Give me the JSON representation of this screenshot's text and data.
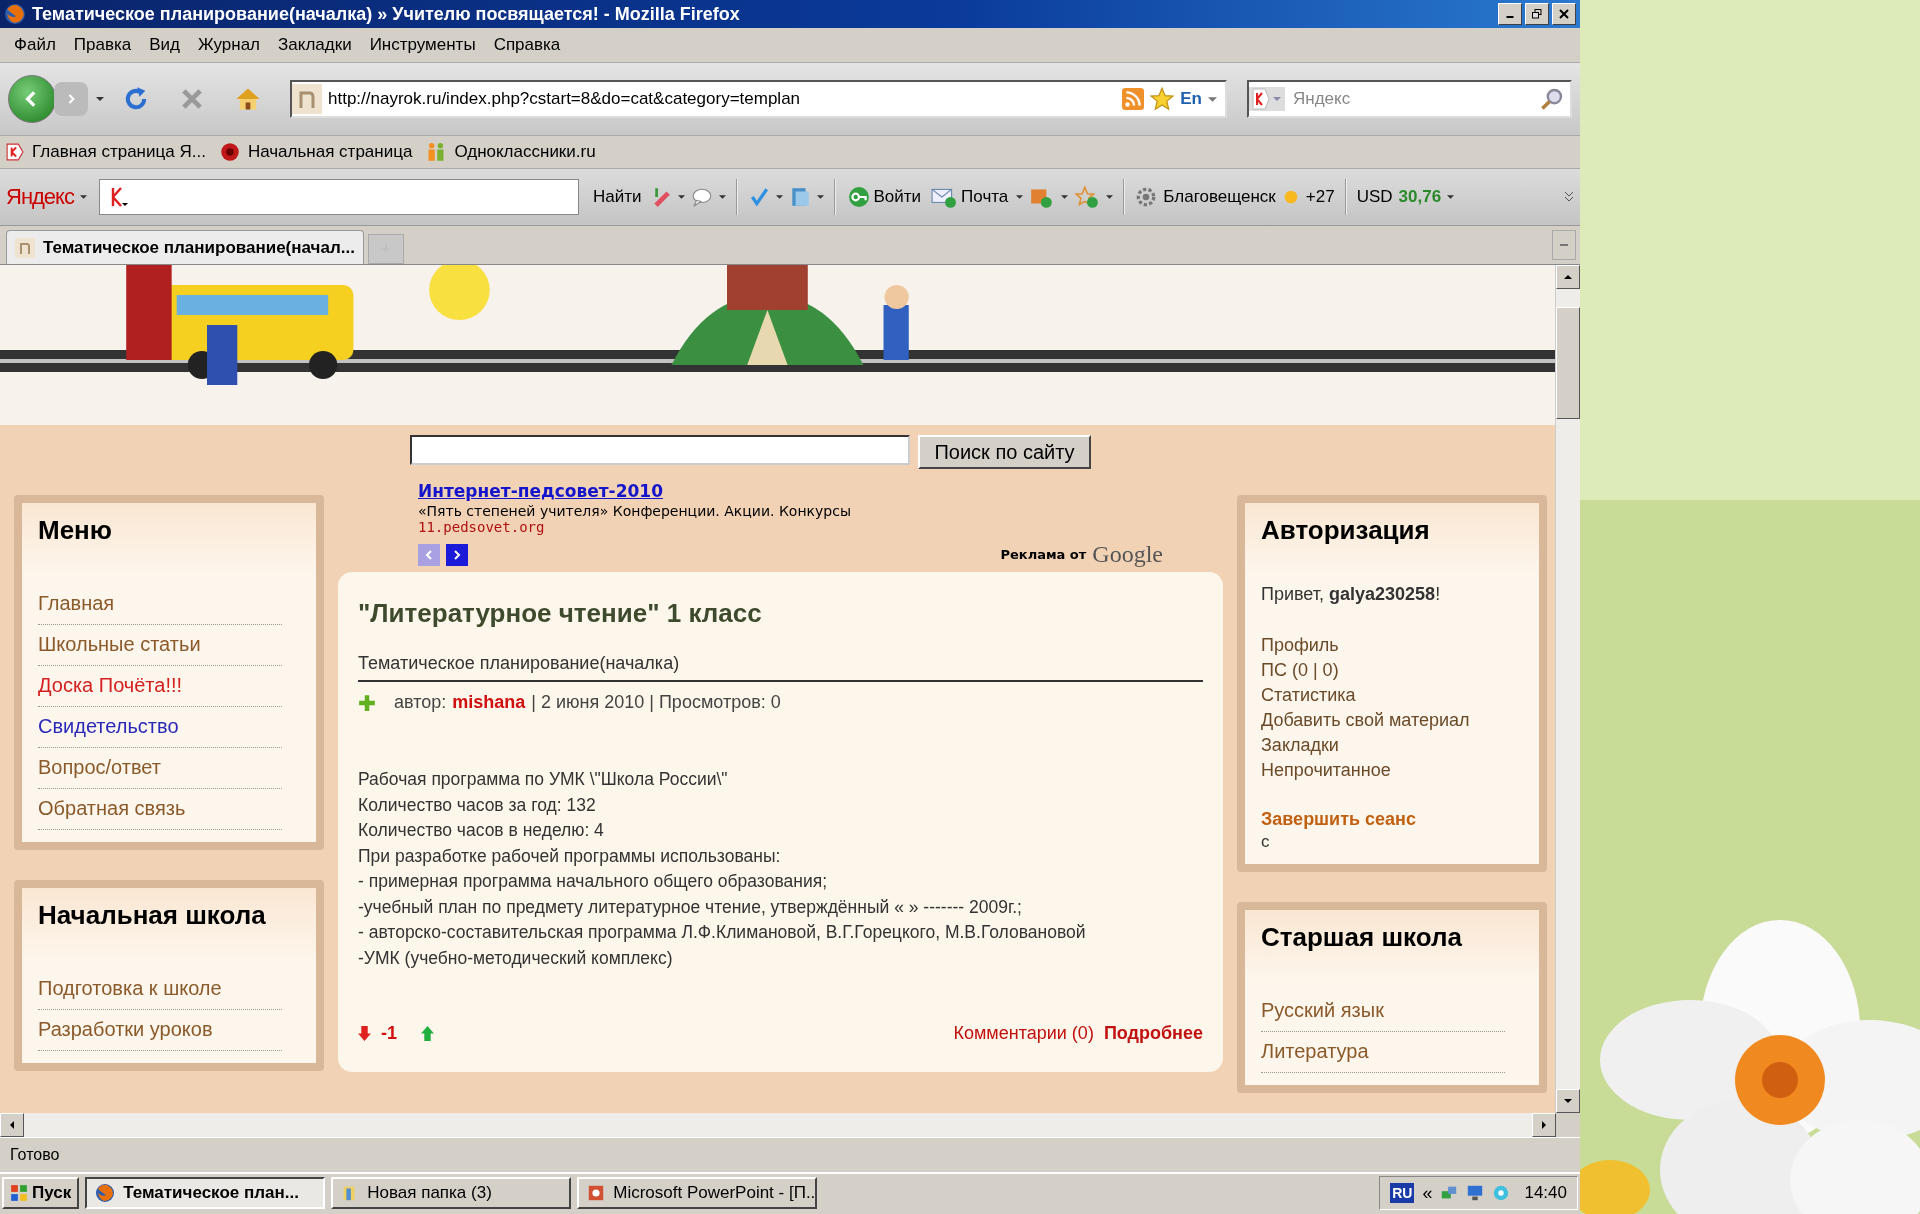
{
  "window": {
    "title": "Тематическое планирование(началка) » Учителю посвящается! - Mozilla Firefox"
  },
  "menu": [
    "Файл",
    "Правка",
    "Вид",
    "Журнал",
    "Закладки",
    "Инструменты",
    "Справка"
  ],
  "navigation": {
    "url": "http://nayrok.ru/index.php?cstart=8&do=cat&category=templan",
    "lang": "En",
    "search_placeholder": "Яндекс"
  },
  "bookmarks": [
    "Главная страница Я...",
    "Начальная страница",
    "Одноклассники.ru"
  ],
  "yandex_bar": {
    "brand": "Яндекс",
    "find": "Найти",
    "login": "Войти",
    "mail": "Почта",
    "city": "Благовещенск",
    "temperature": "+27",
    "currency": "USD",
    "rate": "30,76"
  },
  "tabs": [
    {
      "label": "Тематическое планирование(начал...",
      "selected": true
    }
  ],
  "site": {
    "search_button": "Поиск по сайту",
    "ad": {
      "title": "Интернет-педсовет-2010",
      "text": "«Пять степеней учителя» Конференции. Акции. Конкурсы",
      "url": "11.pedsovet.org",
      "footer": "Реклама от",
      "brand": "Google"
    },
    "left_blocks": [
      {
        "title": "Меню",
        "items": [
          {
            "label": "Главная",
            "color": "#8b5a2b"
          },
          {
            "label": "Школьные статьи",
            "color": "#8b5a2b"
          },
          {
            "label": "Доска Почёта!!!",
            "color": "#d42020"
          },
          {
            "label": "Свидетельство",
            "color": "#2a2ab8"
          },
          {
            "label": "Вопрос/ответ",
            "color": "#8b5a2b"
          },
          {
            "label": "Обратная связь",
            "color": "#8b5a2b"
          }
        ]
      },
      {
        "title": "Начальная школа",
        "items": [
          {
            "label": "Подготовка к школе",
            "color": "#8b5a2b"
          },
          {
            "label": "Разработки уроков",
            "color": "#8b5a2b"
          }
        ]
      }
    ],
    "article": {
      "title": "\"Литературное чтение\" 1 класс",
      "category": "Тематическое планирование(началка)",
      "author_label": "автор:",
      "author": "mishana",
      "meta": "| 2 июня 2010 | Просмотров: 0",
      "lines": [
        "Рабочая программа по УМК \\\"Школа России\\\"",
        "Количество часов за год: 132",
        "Количество часов в неделю: 4",
        "При разработке рабочей программы использованы:",
        "- примерная программа начального общего образования;",
        "-учебный план по предмету литературное чтение, утверждённый « » ------- 2009г.;",
        "- авторско-составительская программа Л.Ф.Климановой, В.Г.Горецкого, М.В.Головановой",
        "-УМК (учебно-методический комплекс)"
      ],
      "rating": "-1",
      "comments": "Комментарии (0)",
      "more": "Подробнее"
    },
    "auth": {
      "title": "Авторизация",
      "greeting": "Привет, **galya230258**!",
      "links": [
        "Профиль",
        "ПС (0 | 0)",
        "Статистика",
        "Добавить свой материал",
        "Закладки",
        "Непрочитанное"
      ],
      "logout": "Завершить сеанс",
      "note": "с"
    },
    "right_blocks": [
      {
        "title": "Старшая школа",
        "items": [
          {
            "label": "Русский язык",
            "color": "#8b5a2b"
          },
          {
            "label": "Литература",
            "color": "#8b5a2b"
          }
        ]
      }
    ]
  },
  "status_bar": "Готово",
  "taskbar": {
    "start": "Пуск",
    "tasks": [
      {
        "label": "Тематическое план...",
        "selected": true
      },
      {
        "label": "Новая папка (3)",
        "selected": false
      },
      {
        "label": "Microsoft PowerPoint - [П...",
        "selected": false
      }
    ],
    "lang": "RU",
    "expand": "«",
    "time": "14:40"
  }
}
